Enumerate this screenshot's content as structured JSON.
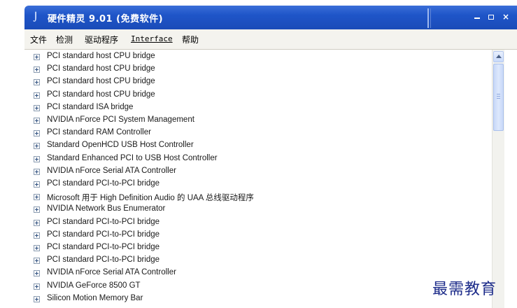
{
  "window": {
    "title": "硬件精灵 9.01 (免费软件)",
    "controls": {
      "minimize": "minimize",
      "maximize": "maximize",
      "close": "×"
    }
  },
  "menubar": {
    "items": [
      "文件",
      "检测",
      "驱动程序",
      "Interface",
      "帮助"
    ]
  },
  "tree": {
    "items": [
      "PCI standard host CPU bridge",
      "PCI standard host CPU bridge",
      "PCI standard host CPU bridge",
      "PCI standard host CPU bridge",
      "PCI standard ISA bridge",
      "NVIDIA nForce PCI System Management",
      "PCI standard RAM Controller",
      "Standard OpenHCD USB Host Controller",
      "Standard Enhanced PCI to USB Host Controller",
      "NVIDIA nForce Serial ATA Controller",
      "PCI standard PCI-to-PCI bridge",
      "Microsoft 用于 High Definition Audio 的 UAA 总线驱动程序",
      "NVIDIA Network Bus Enumerator",
      "PCI standard PCI-to-PCI bridge",
      "PCI standard PCI-to-PCI bridge",
      "PCI standard PCI-to-PCI bridge",
      "PCI standard PCI-to-PCI bridge",
      "NVIDIA nForce Serial ATA Controller",
      "NVIDIA GeForce 8500 GT",
      "Silicon Motion Memory Bar"
    ]
  },
  "watermark": "最需教育",
  "colors": {
    "titlebar": "#1f55c8",
    "menubar": "#f4f3ee",
    "watermark": "#1d2c8a"
  },
  "icons": {
    "app": "app-logo-icon",
    "expander": "plus-box-icon",
    "scroll_up": "chevron-up-icon"
  }
}
